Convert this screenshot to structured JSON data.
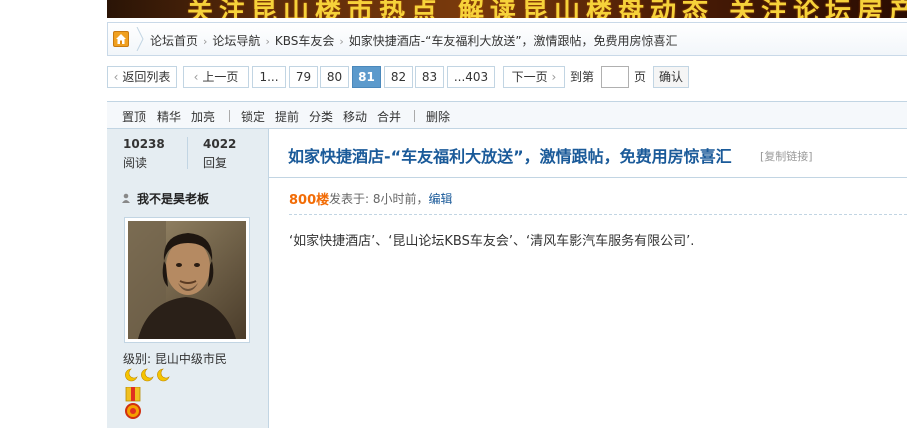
{
  "banner": {
    "text": "关注昆山楼市热点  解读昆山楼盘动态  关注论坛房产"
  },
  "breadcrumb": {
    "items": [
      "论坛首页",
      "论坛导航",
      "KBS车友会",
      "如家快捷酒店-“车友福利大放送”，激情跟帖，免费用房惊喜汇"
    ]
  },
  "pager": {
    "back": "返回列表",
    "prev": "上一页",
    "pages": [
      "1...",
      "79",
      "80",
      "81",
      "82",
      "83",
      "...403"
    ],
    "current": "81",
    "next": "下一页",
    "goto_label": "到第",
    "page_unit": "页",
    "confirm": "确认"
  },
  "mod_toolbar": {
    "group1": [
      "置顶",
      "精华",
      "加亮"
    ],
    "group2": [
      "锁定",
      "提前",
      "分类",
      "移动",
      "合并"
    ],
    "group3": [
      "删除"
    ]
  },
  "thread": {
    "views": "10238",
    "views_label": "阅读",
    "replies": "4022",
    "replies_label": "回复",
    "title": "如家快捷酒店-“车友福利大放送”，激情跟帖，免费用房惊喜汇",
    "copy_link": "[复制链接]"
  },
  "post": {
    "author": "我不是昊老板",
    "level": "级别: 昆山中级市民",
    "floor": "800楼",
    "posted_prefix": "发表于: 8小时前，",
    "edit": "编辑",
    "content": "‘如家快捷酒店’、‘昆山论坛KBS车友会’、‘清风车影汽车服务有限公司’."
  },
  "colors": {
    "link": "#1a5a99",
    "floor": "#f26c06",
    "current_page": "#5c9acc",
    "side_bg": "#e5edf2"
  }
}
